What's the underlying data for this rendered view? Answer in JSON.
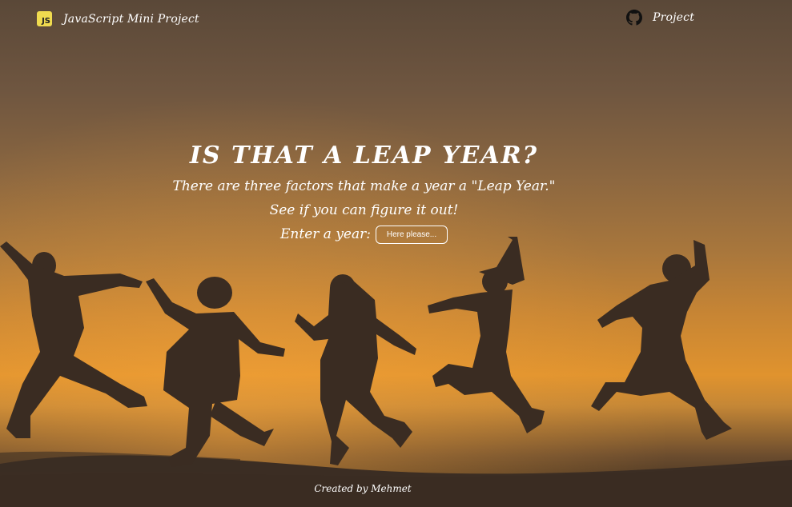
{
  "navbar": {
    "brand_icon": "js-logo-icon",
    "brand_icon_text": "JS",
    "brand_label": "JavaScript Mini Project",
    "project_icon": "github-icon",
    "project_label": "Project"
  },
  "hero": {
    "title": "IS THAT A LEAP YEAR?",
    "line1": "There are three factors that make a year a \"Leap Year.\"",
    "line2": "See if you can figure it out!",
    "prompt": "Enter a year:",
    "input_placeholder": "Here please...",
    "input_value": ""
  },
  "footer": {
    "credit": "Created by Mehmet"
  },
  "colors": {
    "js_yellow": "#f0db4f",
    "silhouette": "#3a2c22",
    "sky_glow": "#e0932e"
  }
}
